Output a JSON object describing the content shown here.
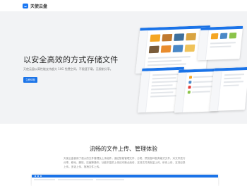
{
  "header": {
    "logo_text": "天使云盘"
  },
  "hero": {
    "title": "以安全高效的方式存储文件",
    "subtitle": "天使云盘以高性能支持超大 10G 免费空间，不限速下载，无限制分享。",
    "button_label": "立即体验"
  },
  "features": {
    "title": "流畅的文件上传、管理体验",
    "description": "天使云盘使用了强大的文件管理及上传组件，通过智能管理文件、分类、预览各种各类格式文件，对文件进行分享、移动、删除、压缩等操作。功能丰富的上传还可断点续传、支持文件夹批量上传、秒传上传、支持目录上传，多选上传、拖拽文件上传。"
  },
  "colors": {
    "brand": "#1a73e8",
    "hero_bg": "#f2f3f5"
  },
  "icons": {
    "logo": "cloud-logo-icon"
  }
}
